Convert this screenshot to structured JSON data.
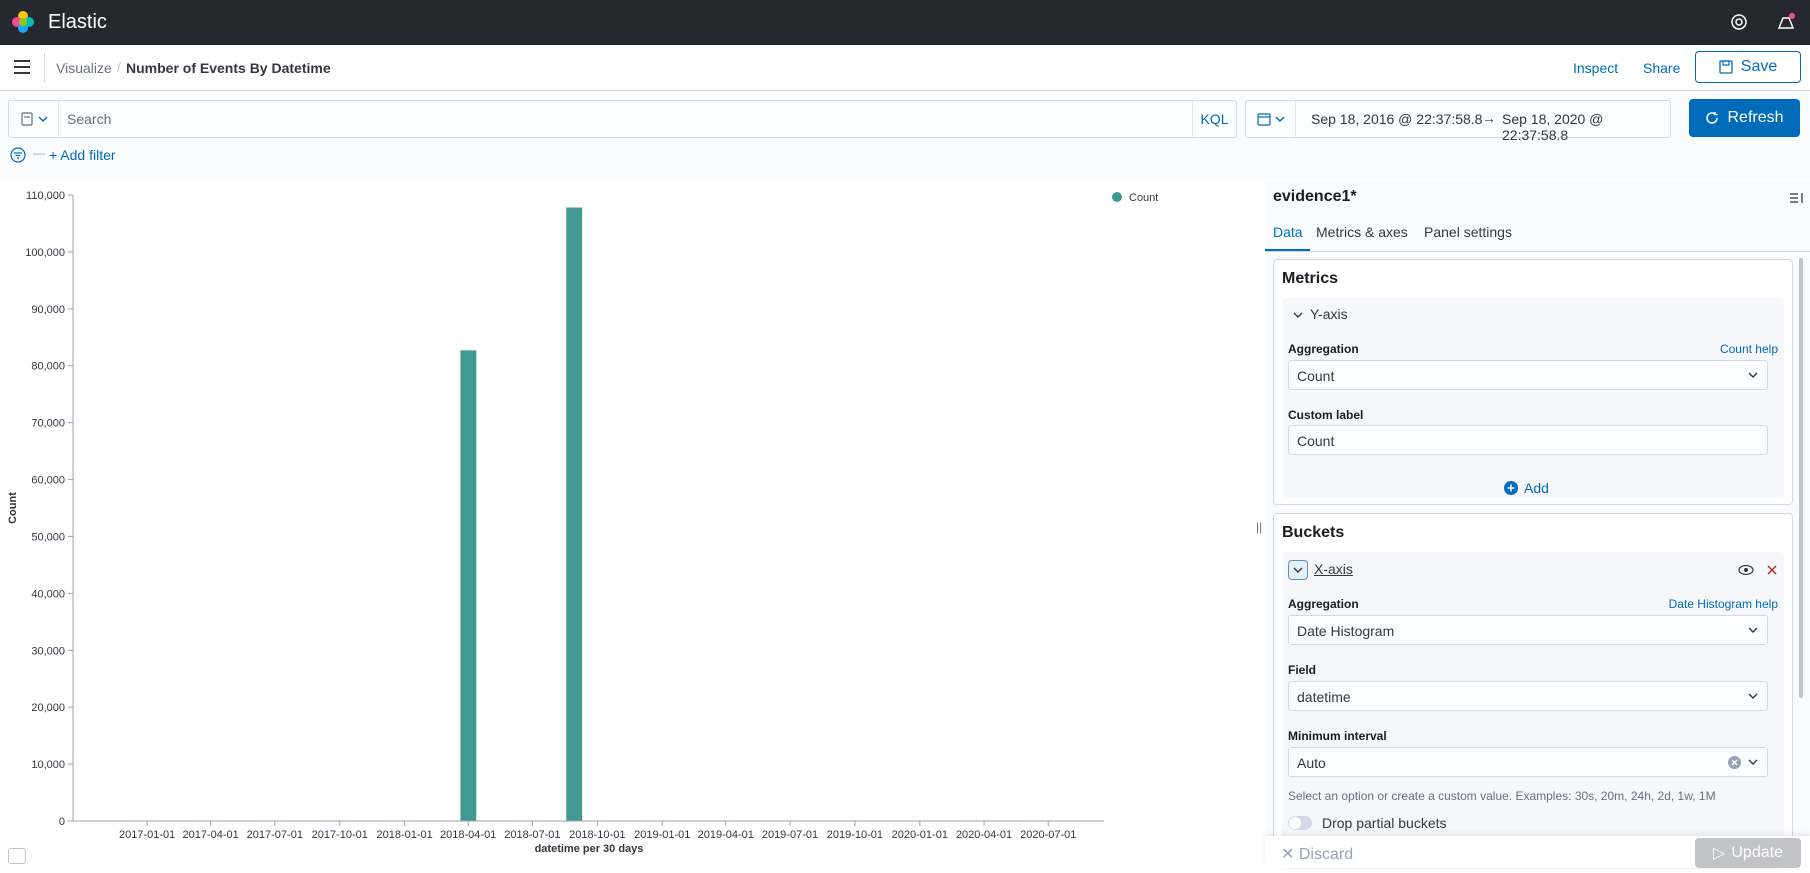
{
  "app": {
    "brand": "Elastic"
  },
  "breadcrumb": {
    "parent": "Visualize",
    "current": "Number of Events By Datetime",
    "separator": "/"
  },
  "nav": {
    "inspect": "Inspect",
    "share": "Share",
    "save": "Save"
  },
  "query": {
    "placeholder": "Search",
    "language": "KQL",
    "add_filter": "+ Add filter"
  },
  "time": {
    "start": "Sep 18, 2016 @ 22:37:58.8",
    "arrow": "→",
    "end": "Sep 18, 2020 @ 22:37:58.8",
    "refresh": "Refresh"
  },
  "chart_data": {
    "type": "bar",
    "xlabel": "datetime per 30 days",
    "ylabel": "Count",
    "legend": [
      "Count"
    ],
    "legend_position": "top-right",
    "ylim": [
      0,
      110000
    ],
    "yticks": [
      0,
      10000,
      20000,
      30000,
      40000,
      50000,
      60000,
      70000,
      80000,
      90000,
      100000,
      110000
    ],
    "ytick_labels": [
      "0",
      "10,000",
      "20,000",
      "30,000",
      "40,000",
      "50,000",
      "60,000",
      "70,000",
      "80,000",
      "90,000",
      "100,000",
      "110,000"
    ],
    "xlim": [
      "2016-09-18",
      "2020-09-18"
    ],
    "xticks": [
      "2017-01-01",
      "2017-04-01",
      "2017-07-01",
      "2017-10-01",
      "2018-01-01",
      "2018-04-01",
      "2018-07-01",
      "2018-10-01",
      "2019-01-01",
      "2019-04-01",
      "2019-07-01",
      "2019-10-01",
      "2020-01-01",
      "2020-04-01",
      "2020-07-01"
    ],
    "bar_width_days": 30,
    "points": [
      {
        "x": "2018-03-21",
        "y": 82700
      },
      {
        "x": "2018-08-18",
        "y": 107800
      }
    ],
    "color": "#409a8f"
  },
  "sidebar": {
    "index_pattern": "evidence1*",
    "tabs": [
      "Data",
      "Metrics & axes",
      "Panel settings"
    ],
    "metrics": {
      "title": "Metrics",
      "agg_title": "Y-axis",
      "aggregation_label": "Aggregation",
      "aggregation_help": "Count help",
      "aggregation_value": "Count",
      "custom_label_label": "Custom label",
      "custom_label_value": "Count",
      "add": "Add"
    },
    "buckets": {
      "title": "Buckets",
      "agg_title": "X-axis",
      "aggregation_label": "Aggregation",
      "aggregation_help": "Date Histogram help",
      "aggregation_value": "Date Histogram",
      "field_label": "Field",
      "field_value": "datetime",
      "interval_label": "Minimum interval",
      "interval_value": "Auto",
      "interval_help": "Select an option or create a custom value. Examples: 30s, 20m, 24h, 2d, 1w, 1M",
      "drop_partial": "Drop partial buckets"
    },
    "discard": "Discard",
    "update": "Update"
  },
  "colors": {
    "primary": "#006bb8",
    "header_bg": "#25282f",
    "bar": "#409a8f"
  }
}
